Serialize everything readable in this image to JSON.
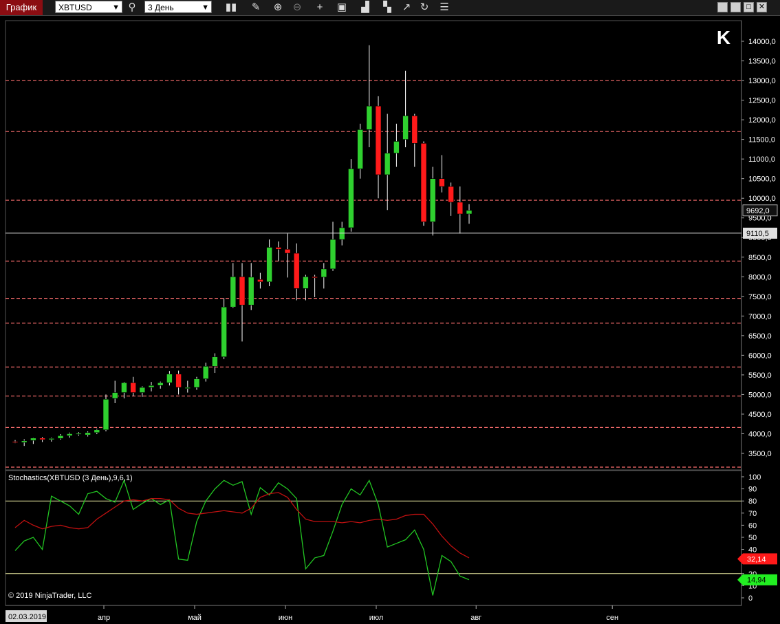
{
  "toolbar": {
    "tab_title": "График",
    "instrument": "XBTUSD",
    "period": "3 День",
    "icons": [
      "search-icon",
      "bar-style-icon",
      "pencil-icon",
      "zoom-in-icon",
      "zoom-out-icon",
      "crosshair-icon",
      "data-box-icon",
      "bar-types-icon",
      "steps-icon",
      "indicators-icon",
      "refresh-icon",
      "properties-icon"
    ],
    "window_buttons": [
      "minimize-icon",
      "restore-icon",
      "maximize-icon",
      "close-icon"
    ]
  },
  "colors": {
    "up": "#2fd02f",
    "down": "#ff1a1a",
    "wick": "#ffffff",
    "level_line": "#ff7070",
    "k_line": "#22c522",
    "d_line": "#c01010",
    "band_line": "#e8e8a0"
  },
  "chart_data": [
    {
      "type": "candlestick",
      "instrument": "XBTUSD",
      "ylim": [
        3100,
        14300
      ],
      "y_ticks": [
        3500,
        4000,
        4500,
        5000,
        5500,
        6000,
        6500,
        7000,
        7500,
        8000,
        8500,
        9000,
        9500,
        10000,
        10500,
        11000,
        11500,
        12000,
        12500,
        13000,
        13500,
        14000
      ],
      "y_tick_labels": [
        "3500,0",
        "4000,0",
        "4500,0",
        "5000,0",
        "5500,0",
        "6000,0",
        "6500,0",
        "7000,0",
        "7500,0",
        "8000,0",
        "8500,0",
        "9000,0",
        "9500,0",
        "10000,0",
        "10500,0",
        "11000,0",
        "11500,0",
        "12000,0",
        "12500,0",
        "13000,0",
        "13500,0",
        "14000,0"
      ],
      "x_labels": [
        {
          "label": "02.03.2019",
          "bar": 0
        },
        {
          "label": "апр",
          "bar": 10
        },
        {
          "label": "май",
          "bar": 20
        },
        {
          "label": "июн",
          "bar": 30
        },
        {
          "label": "июл",
          "bar": 40
        },
        {
          "label": "авг",
          "bar": 51
        },
        {
          "label": "сен",
          "bar": 66
        }
      ],
      "total_bars": 80,
      "candles": [
        {
          "o": 3800,
          "h": 3840,
          "l": 3760,
          "c": 3780
        },
        {
          "o": 3780,
          "h": 3860,
          "l": 3690,
          "c": 3820
        },
        {
          "o": 3830,
          "h": 3900,
          "l": 3740,
          "c": 3890
        },
        {
          "o": 3890,
          "h": 3920,
          "l": 3790,
          "c": 3850
        },
        {
          "o": 3850,
          "h": 3900,
          "l": 3800,
          "c": 3880
        },
        {
          "o": 3880,
          "h": 3990,
          "l": 3850,
          "c": 3950
        },
        {
          "o": 3950,
          "h": 4030,
          "l": 3900,
          "c": 4000
        },
        {
          "o": 3990,
          "h": 4040,
          "l": 3950,
          "c": 4010
        },
        {
          "o": 3970,
          "h": 4060,
          "l": 3930,
          "c": 4030
        },
        {
          "o": 4030,
          "h": 4130,
          "l": 3990,
          "c": 4100
        },
        {
          "o": 4100,
          "h": 5000,
          "l": 4060,
          "c": 4880
        },
        {
          "o": 4900,
          "h": 5350,
          "l": 4780,
          "c": 5050
        },
        {
          "o": 5050,
          "h": 5320,
          "l": 4900,
          "c": 5300
        },
        {
          "o": 5300,
          "h": 5450,
          "l": 4960,
          "c": 5050
        },
        {
          "o": 5050,
          "h": 5210,
          "l": 4940,
          "c": 5180
        },
        {
          "o": 5180,
          "h": 5320,
          "l": 5080,
          "c": 5230
        },
        {
          "o": 5230,
          "h": 5330,
          "l": 5150,
          "c": 5300
        },
        {
          "o": 5300,
          "h": 5600,
          "l": 5230,
          "c": 5520
        },
        {
          "o": 5520,
          "h": 5610,
          "l": 5000,
          "c": 5180
        },
        {
          "o": 5180,
          "h": 5350,
          "l": 5050,
          "c": 5180
        },
        {
          "o": 5180,
          "h": 5450,
          "l": 5120,
          "c": 5400
        },
        {
          "o": 5400,
          "h": 5810,
          "l": 5330,
          "c": 5720
        },
        {
          "o": 5720,
          "h": 6050,
          "l": 5550,
          "c": 5960
        },
        {
          "o": 5960,
          "h": 7450,
          "l": 5900,
          "c": 7230
        },
        {
          "o": 7230,
          "h": 8350,
          "l": 7200,
          "c": 8000
        },
        {
          "o": 8000,
          "h": 8350,
          "l": 6350,
          "c": 7280
        },
        {
          "o": 7280,
          "h": 8350,
          "l": 7150,
          "c": 7990
        },
        {
          "o": 7930,
          "h": 8100,
          "l": 7700,
          "c": 7870
        },
        {
          "o": 7870,
          "h": 8950,
          "l": 7760,
          "c": 8750
        },
        {
          "o": 8750,
          "h": 8900,
          "l": 8400,
          "c": 8700
        },
        {
          "o": 8700,
          "h": 9100,
          "l": 7980,
          "c": 8600
        },
        {
          "o": 8600,
          "h": 8850,
          "l": 7400,
          "c": 7700
        },
        {
          "o": 7700,
          "h": 8050,
          "l": 7400,
          "c": 8000
        },
        {
          "o": 8000,
          "h": 8050,
          "l": 7480,
          "c": 7990
        },
        {
          "o": 7990,
          "h": 8350,
          "l": 7700,
          "c": 8200
        },
        {
          "o": 8200,
          "h": 9400,
          "l": 8150,
          "c": 8950
        },
        {
          "o": 8950,
          "h": 9400,
          "l": 8800,
          "c": 9250
        },
        {
          "o": 9250,
          "h": 11000,
          "l": 9150,
          "c": 10750
        },
        {
          "o": 10750,
          "h": 11900,
          "l": 10500,
          "c": 11750
        },
        {
          "o": 11750,
          "h": 13900,
          "l": 11300,
          "c": 12350
        },
        {
          "o": 12350,
          "h": 12600,
          "l": 10000,
          "c": 10600
        },
        {
          "o": 10600,
          "h": 12150,
          "l": 9700,
          "c": 11150
        },
        {
          "o": 11150,
          "h": 11900,
          "l": 10800,
          "c": 11450
        },
        {
          "o": 11500,
          "h": 13250,
          "l": 11300,
          "c": 12100
        },
        {
          "o": 12100,
          "h": 12150,
          "l": 10800,
          "c": 11400
        },
        {
          "o": 11400,
          "h": 11450,
          "l": 9300,
          "c": 9400
        },
        {
          "o": 9400,
          "h": 10800,
          "l": 9050,
          "c": 10500
        },
        {
          "o": 10500,
          "h": 11100,
          "l": 10150,
          "c": 10300
        },
        {
          "o": 10300,
          "h": 10400,
          "l": 9550,
          "c": 9900
        },
        {
          "o": 9900,
          "h": 10300,
          "l": 9100,
          "c": 9600
        },
        {
          "o": 9600,
          "h": 9850,
          "l": 9350,
          "c": 9692
        }
      ],
      "level_lines": [
        13000,
        11700,
        9950,
        8400,
        7450,
        6820,
        5700,
        4960,
        4160,
        3150
      ],
      "crosshair_price": 9110.5,
      "crosshair_label": "9110,5",
      "last_price_label": "9692,0",
      "last_price": 9692
    },
    {
      "type": "line",
      "indicator_label": "Stochastics(XBTUSD (3 День),9,6,1)",
      "ylim": [
        0,
        100
      ],
      "y_ticks": [
        0,
        10,
        20,
        30,
        40,
        50,
        60,
        70,
        80,
        90,
        100
      ],
      "y_tick_labels": [
        "0",
        "10",
        "20",
        "30",
        "40",
        "50",
        "60",
        "70",
        "80",
        "90",
        "100"
      ],
      "bands": [
        80,
        20
      ],
      "series": [
        {
          "name": "K",
          "values": [
            39,
            47,
            50,
            40,
            84,
            80,
            76,
            69,
            86,
            88,
            82,
            79,
            97,
            73,
            78,
            82,
            77,
            81,
            32,
            31,
            63,
            80,
            90,
            97,
            93,
            96,
            69,
            91,
            85,
            95,
            90,
            82,
            24,
            33,
            35,
            55,
            77,
            90,
            85,
            97,
            77,
            42,
            45,
            48,
            56,
            40,
            2,
            35,
            30,
            18,
            15
          ]
        },
        {
          "name": "D",
          "values": [
            58,
            64,
            60,
            57,
            59,
            60,
            58,
            57,
            58,
            65,
            70,
            75,
            80,
            81,
            80,
            82,
            82,
            81,
            74,
            70,
            69,
            70,
            71,
            72,
            71,
            70,
            74,
            83,
            86,
            87,
            83,
            73,
            65,
            63,
            63,
            63,
            62,
            63,
            62,
            64,
            65,
            64,
            65,
            68,
            69,
            69,
            61,
            51,
            43,
            37,
            33
          ]
        }
      ],
      "k_last_label": "14,94",
      "d_last_label": "32,14",
      "k_last": 14.94,
      "d_last": 32.14
    }
  ],
  "footer": {
    "copyright": "© 2019 NinjaTrader, LLC",
    "ninja_logo": "K"
  }
}
